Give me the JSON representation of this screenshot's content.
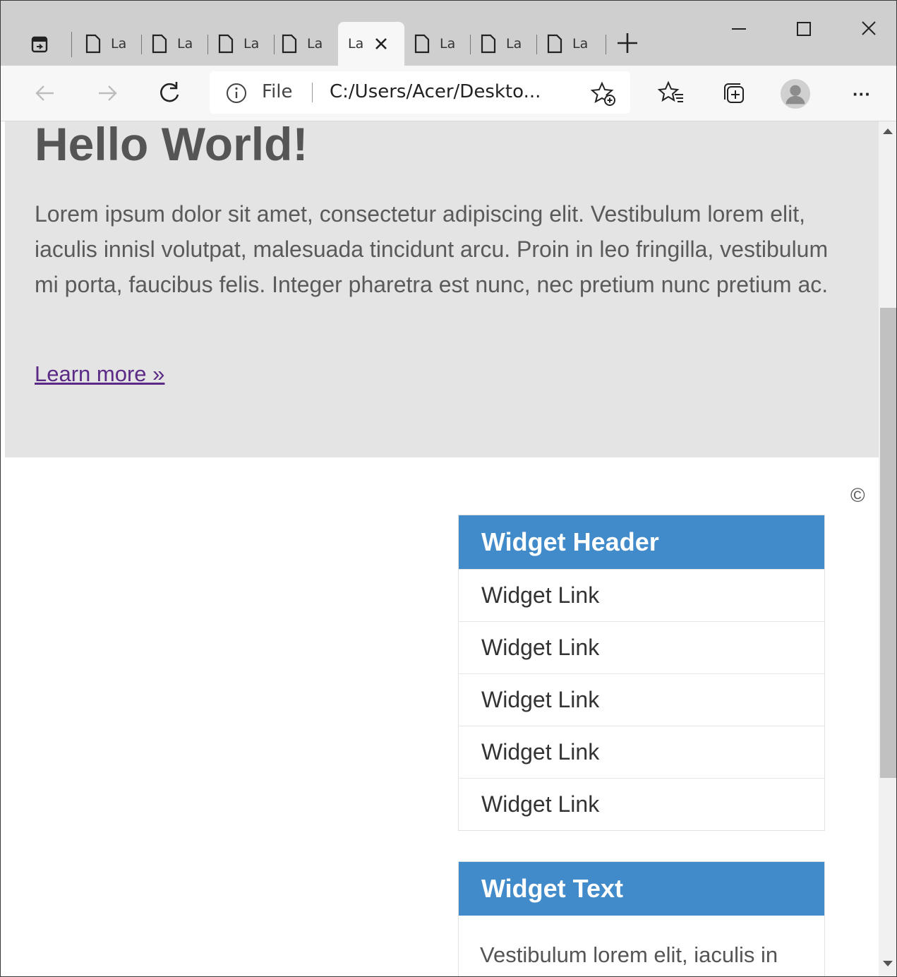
{
  "browser": {
    "tabs": [
      {
        "label": "La",
        "active": false
      },
      {
        "label": "La",
        "active": false
      },
      {
        "label": "La",
        "active": false
      },
      {
        "label": "La",
        "active": false
      },
      {
        "label": "La",
        "active": true
      },
      {
        "label": "La",
        "active": false
      },
      {
        "label": "La",
        "active": false
      },
      {
        "label": "La",
        "active": false
      }
    ],
    "address": {
      "scheme_label": "File",
      "url": "C:/Users/Acer/Deskto..."
    },
    "more_label": "···"
  },
  "page": {
    "jumbotron": {
      "heading": "Hello World!",
      "text": "Lorem ipsum dolor sit amet, consectetur adipiscing elit. Vestibulum lorem elit, iaculis innisl volutpat, malesuada tincidunt arcu. Proin in leo fringilla, vestibulum mi porta, faucibus felis. Integer pharetra est nunc, nec pretium nunc pretium ac.",
      "link": "Learn more »"
    },
    "copyright": "©",
    "widget_links": {
      "header": "Widget Header",
      "links": [
        "Widget Link",
        "Widget Link",
        "Widget Link",
        "Widget Link",
        "Widget Link"
      ]
    },
    "widget_text": {
      "header": "Widget Text",
      "body": "Vestibulum lorem elit, iaculis in"
    }
  },
  "colors": {
    "widget_header": "#428bca",
    "jumbotron_bg": "#e4e4e4",
    "visited_link": "#5b2a86"
  }
}
